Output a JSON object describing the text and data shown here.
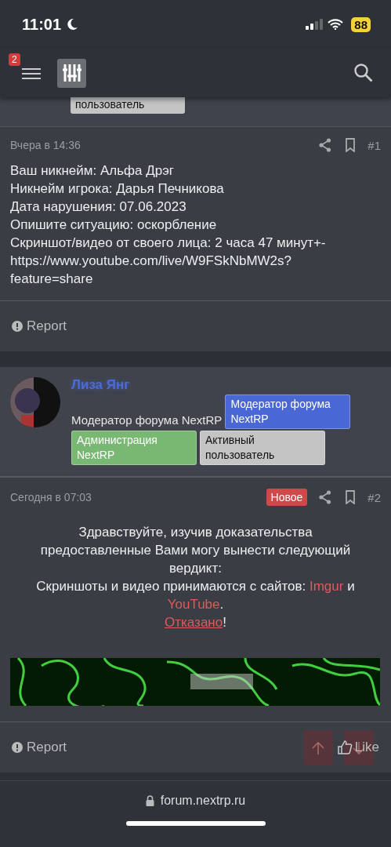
{
  "status_bar": {
    "time": "11:01",
    "battery": "88"
  },
  "header": {
    "notification_count": "2"
  },
  "prev_post": {
    "badge": "пользователь"
  },
  "posts": [
    {
      "date": "Вчера в 14:36",
      "is_new": false,
      "number": "#1",
      "kind": "plain",
      "lines": [
        [
          {
            "kind": "text",
            "text": "Ваш никнейм: Альфа Дрэг"
          }
        ],
        [
          {
            "kind": "text",
            "text": "Никнейм игрока: Дарья Печникова"
          }
        ],
        [
          {
            "kind": "text",
            "text": "Дата нарушения: 07.06.2023"
          }
        ],
        [
          {
            "kind": "text",
            "text": "Опишите ситуацию: оскорбление"
          }
        ],
        [
          {
            "kind": "text",
            "text": "Скриншот/видео от своего лица: 2 часа 47 минут+- https://www.youtube.com/live/W9FSkNbMW2s?feature=share"
          }
        ]
      ],
      "has_banner": false,
      "report": "Report"
    },
    {
      "author": {
        "name": "Лиза Янг",
        "title": "Модератор форума NextRP",
        "badges": [
          {
            "text": "Модератор форума NextRP",
            "color": "#4a67d6"
          },
          {
            "text": "Администрация NextRP",
            "color": "#79b873"
          },
          {
            "text": "Активный пользователь",
            "color": "#c4c4c4"
          }
        ]
      },
      "date": "Сегодня в 07:03",
      "is_new": true,
      "new_label": "Новое",
      "number": "#2",
      "kind": "verdict",
      "lines": [
        [
          {
            "kind": "text",
            "text": "Здравствуйте, изучив доказательства предоставленные Вами могу вынести следующий вердикт:"
          }
        ],
        [
          {
            "kind": "text",
            "text": "Скриншоты и видео принимаются с сайтов: "
          },
          {
            "kind": "link",
            "text": "Imgur"
          },
          {
            "kind": "text",
            "text": " и "
          },
          {
            "kind": "link",
            "text": "YouTube"
          },
          {
            "kind": "text",
            "text": "."
          }
        ],
        [
          {
            "kind": "underline-link",
            "text": "Отказано"
          },
          {
            "kind": "text",
            "text": "!"
          }
        ]
      ],
      "has_banner": true,
      "report": "Report",
      "like": "Like"
    }
  ],
  "address_bar": {
    "url": "forum.nextrp.ru"
  }
}
